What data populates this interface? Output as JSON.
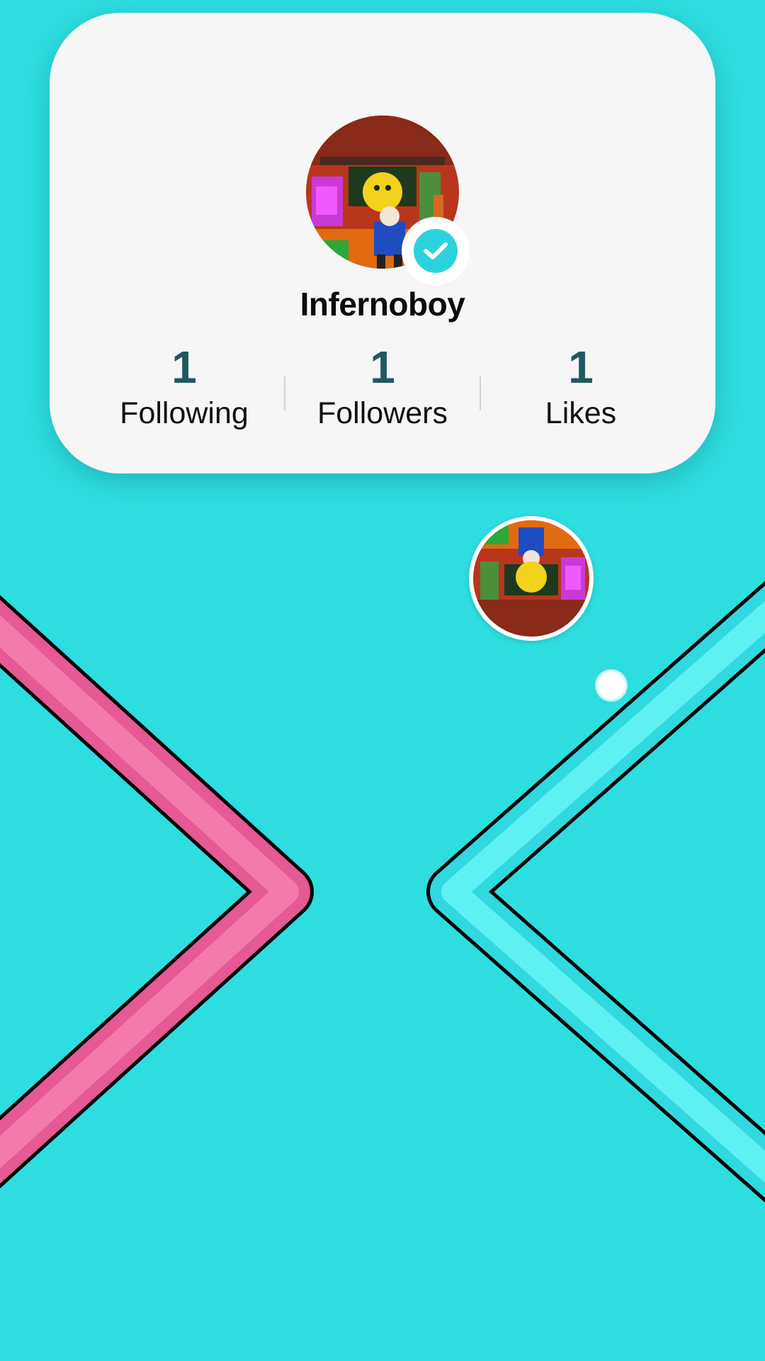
{
  "profile": {
    "username": "Infernoboy",
    "verified": true,
    "stats": [
      {
        "value": "1",
        "label": "Following"
      },
      {
        "value": "1",
        "label": "Followers"
      },
      {
        "value": "1",
        "label": "Likes"
      }
    ]
  },
  "game": {
    "left_paddle_color": "#f0699e",
    "right_paddle_color": "#3ae4ea",
    "background_color": "#2ddde0",
    "ball_icon": "ball-icon",
    "player_avatar_icon": "player-avatar-icon"
  },
  "colors": {
    "accent": "#2ad3dc",
    "stat_number": "#1f5963",
    "card_background": "#f6f6f7"
  }
}
